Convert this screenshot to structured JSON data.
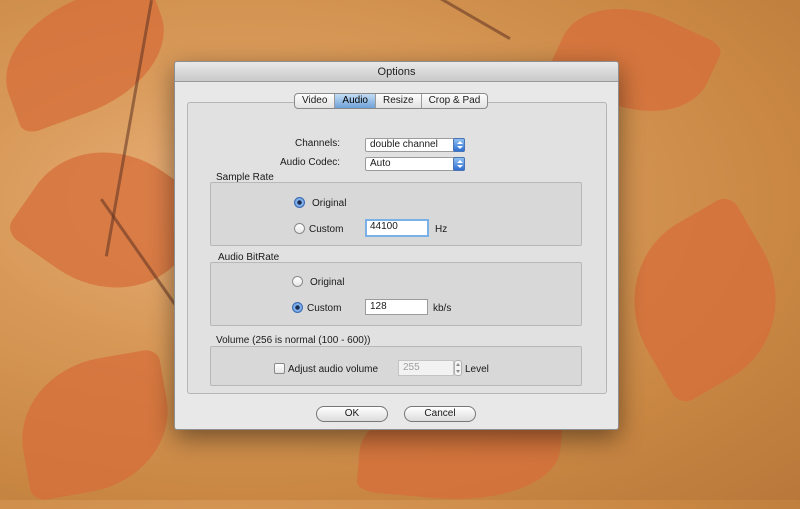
{
  "window": {
    "title": "Options"
  },
  "tabs": [
    {
      "label": "Video",
      "active": false
    },
    {
      "label": "Audio",
      "active": true
    },
    {
      "label": "Resize",
      "active": false
    },
    {
      "label": "Crop & Pad",
      "active": false
    }
  ],
  "audio": {
    "channels_label": "Channels:",
    "channels_value": "double channel",
    "codec_label": "Audio Codec:",
    "codec_value": "Auto"
  },
  "sample_rate": {
    "title": "Sample Rate",
    "original_label": "Original",
    "custom_label": "Custom",
    "selected": "original",
    "value": "44100",
    "unit": "Hz"
  },
  "bitrate": {
    "title": "Audio BitRate",
    "original_label": "Original",
    "custom_label": "Custom",
    "selected": "custom",
    "value": "128",
    "unit": "kb/s"
  },
  "volume": {
    "title": "Volume (256 is normal (100 - 600))",
    "adjust_label": "Adjust audio volume",
    "checked": false,
    "value": "255",
    "unit": "Level"
  },
  "buttons": {
    "ok": "OK",
    "cancel": "Cancel"
  },
  "colors": {
    "accent": "#4d89d8",
    "tab_active": "#6ea2d8"
  }
}
